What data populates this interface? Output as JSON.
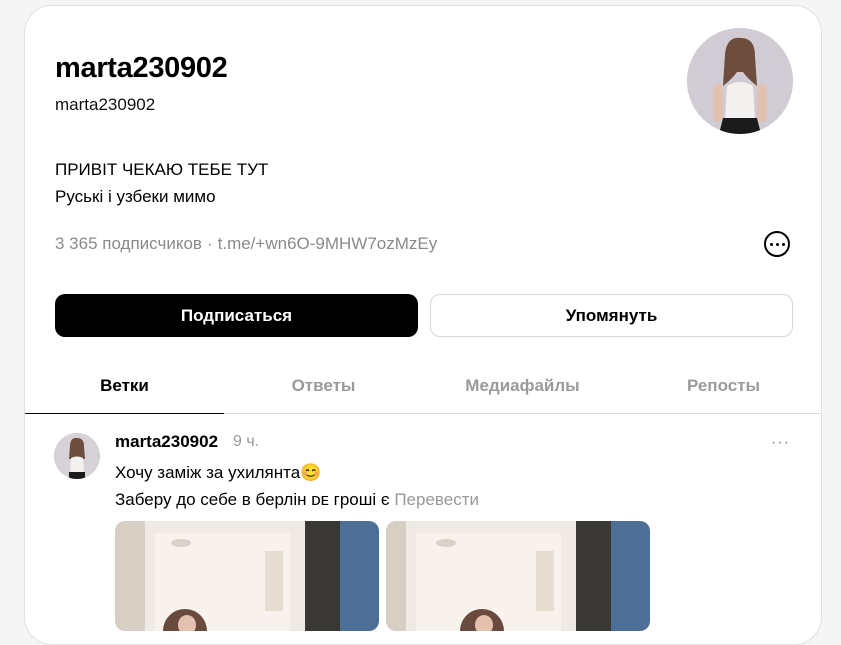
{
  "profile": {
    "display_name": "marta230902",
    "handle": "marta230902",
    "bio_line1": "ПРИВІТ ЧЕКАЮ ТЕБЕ ТУТ ",
    "bio_line2": "Руські і узбеки мимо",
    "followers": "3 365 подписчиков",
    "separator": "·",
    "link": "t.me/+wn6O-9MHW7ozMzEy"
  },
  "actions": {
    "follow_label": "Подписаться",
    "mention_label": "Упомянуть"
  },
  "tabs": [
    {
      "label": "Ветки",
      "active": true
    },
    {
      "label": "Ответы",
      "active": false
    },
    {
      "label": "Медиафайлы",
      "active": false
    },
    {
      "label": "Репосты",
      "active": false
    }
  ],
  "post": {
    "author": "marta230902",
    "time": "9 ч.",
    "menu": "···",
    "line1": "Хочу заміж за ухилянта😊",
    "line2": "Заберу до себе в берлін ᴅᴇ гроші є",
    "translate_label": "Перевести"
  },
  "icons": {
    "more": "more-options-icon",
    "post_more": "ellipsis-icon"
  },
  "colors": {
    "primary_button": "#000000",
    "muted_text": "#8a8a8a"
  }
}
